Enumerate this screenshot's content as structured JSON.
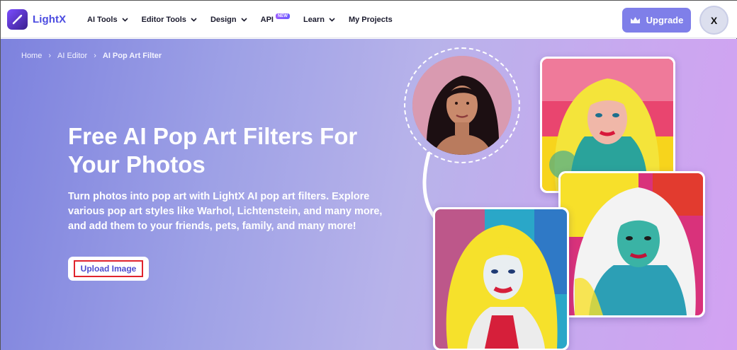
{
  "nav": {
    "logo_text": "LightX",
    "logo_icon": "lightx-logo-icon",
    "items": [
      {
        "label": "AI Tools",
        "dropdown": true
      },
      {
        "label": "Editor Tools",
        "dropdown": true
      },
      {
        "label": "Design",
        "dropdown": true
      },
      {
        "label": "API",
        "dropdown": false,
        "badge": "NEW"
      },
      {
        "label": "Learn",
        "dropdown": true
      },
      {
        "label": "My Projects",
        "dropdown": false
      }
    ],
    "upgrade_label": "Upgrade",
    "upgrade_icon": "crown-icon",
    "avatar_initial": "X"
  },
  "breadcrumb": {
    "items": [
      "Home",
      "AI Editor",
      "AI Pop Art Filter"
    ]
  },
  "hero": {
    "title": "Free AI Pop Art Filters For Your Photos",
    "description": "Turn photos into pop art with LightX AI pop art filters. Explore various pop art styles like Warhol, Lichtenstein, and many more, and add them to your friends, pets, family, and many more!",
    "upload_label": "Upload Image"
  },
  "colors": {
    "brand": "#4b4be0",
    "upgrade_bg": "#7f7fe9",
    "hero_start": "#7d82de",
    "hero_end": "#d3a2f2",
    "highlight_border": "#e0242c"
  }
}
